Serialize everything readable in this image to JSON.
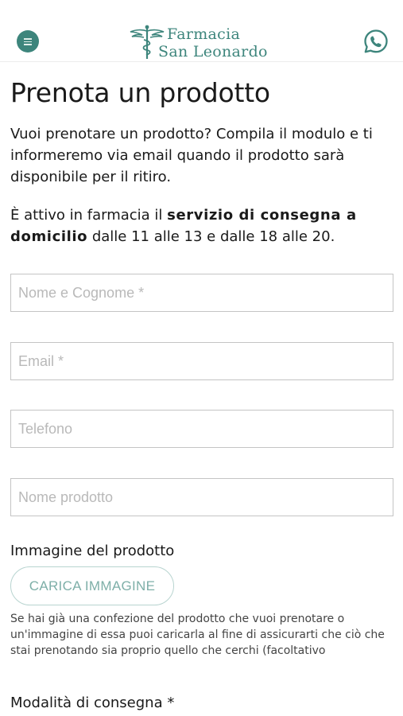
{
  "header": {
    "logo_line1": "Farmacia",
    "logo_line2": "San Leonardo",
    "brand_color": "#3d857c",
    "menu_icon": "hamburger-icon",
    "whatsapp_icon": "whatsapp-icon"
  },
  "page": {
    "title": "Prenota un prodotto",
    "intro": "Vuoi prenotare un prodotto? Compila il modulo e ti informeremo via email quando il prodotto sarà disponibile per il ritiro.",
    "service_prefix": "È attivo in farmacia il ",
    "service_bold": "servizio di consegna a domicilio",
    "service_suffix": " dalle 11 alle 13 e dalle 18 alle 20."
  },
  "form": {
    "name_placeholder": "Nome e Cognome *",
    "email_placeholder": "Email *",
    "phone_placeholder": "Telefono",
    "product_placeholder": "Nome prodotto",
    "image_label": "Immagine del prodotto",
    "upload_label": "CARICA IMMAGINE",
    "image_help": "Se hai già una confezione del prodotto che vuoi prenotare o un'immagine di essa puoi caricarla al fine di assicurarti che ciò che stai prenotando sia proprio quello che cerchi (facoltativo",
    "delivery_label": "Modalità di consegna *"
  }
}
